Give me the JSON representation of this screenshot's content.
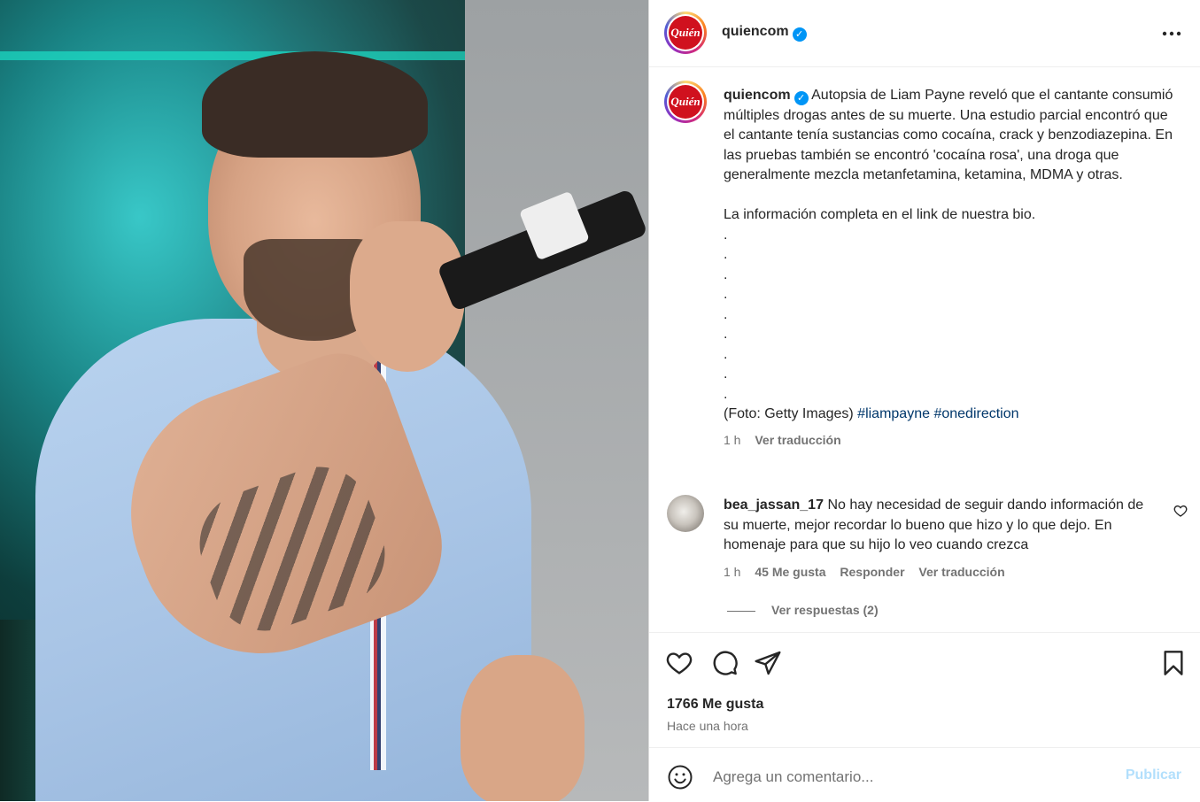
{
  "post": {
    "username": "quiencom",
    "avatar_text": "Quién",
    "more_label": "•••"
  },
  "caption": {
    "username": "quiencom",
    "paragraph1": "Autopsia de Liam Payne reveló que el cantante consumió múltiples drogas antes de su muerte. Una estudio parcial encontró que el cantante tenía sustancias como cocaína, crack y benzodiazepina. En las pruebas también se encontró 'cocaína rosa', una droga que generalmente mezcla metanfetamina, ketamina, MDMA y otras.",
    "paragraph2": "La información completa en el link de nuestra bio.",
    "dots": [
      ".",
      ".",
      ".",
      ".",
      ".",
      ".",
      ".",
      ".",
      "."
    ],
    "credit": "(Foto: Getty Images)",
    "hashtags": [
      "#liampayne",
      "#onedirection"
    ],
    "time": "1 h",
    "translate": "Ver traducción"
  },
  "comment": {
    "username": "bea_jassan_17",
    "text": "No hay necesidad de seguir dando información de su muerte, mejor recordar lo bueno que hizo y lo que dejo. En homenaje para que su hijo lo veo cuando crezca",
    "time": "1 h",
    "likes": "45 Me gusta",
    "reply": "Responder",
    "translate": "Ver traducción",
    "view_replies": "Ver respuestas (2)"
  },
  "actions": {
    "likes": "1766 Me gusta",
    "ago": "Hace una hora"
  },
  "add_comment": {
    "placeholder": "Agrega un comentario...",
    "publish": "Publicar"
  },
  "colors": {
    "verified": "#0095f6",
    "brand_red": "#d0111e",
    "hashtag": "#00376b",
    "publish_disabled": "#b2dffc"
  }
}
